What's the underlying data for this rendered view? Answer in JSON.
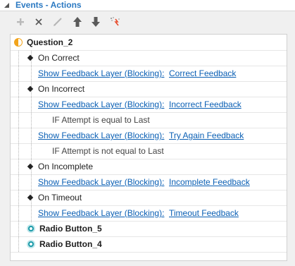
{
  "panel": {
    "title": "Events - Actions"
  },
  "toolbar": [
    {
      "name": "add-icon"
    },
    {
      "name": "delete-icon"
    },
    {
      "name": "edit-icon"
    },
    {
      "name": "move-up-icon"
    },
    {
      "name": "move-down-icon"
    },
    {
      "name": "magic-wand-icon"
    }
  ],
  "tree": {
    "root": "Question_2",
    "events": [
      {
        "label": "On Correct",
        "actions": [
          {
            "action": "Show Feedback Layer (Blocking):",
            "target": "Correct Feedback"
          }
        ]
      },
      {
        "label": "On Incorrect",
        "actions": [
          {
            "action": "Show Feedback Layer (Blocking):",
            "target": "Incorrect Feedback"
          },
          {
            "condition": "IF Attempt is equal to Last"
          },
          {
            "action": "Show Feedback Layer (Blocking):",
            "target": "Try Again Feedback"
          },
          {
            "condition": "IF Attempt is not equal to Last"
          }
        ]
      },
      {
        "label": "On Incomplete",
        "actions": [
          {
            "action": "Show Feedback Layer (Blocking):",
            "target": "Incomplete Feedback"
          }
        ]
      },
      {
        "label": "On Timeout",
        "actions": [
          {
            "action": "Show Feedback Layer (Blocking):",
            "target": "Timeout Feedback"
          }
        ]
      }
    ],
    "objects": [
      "Radio Button_5",
      "Radio Button_4"
    ]
  }
}
